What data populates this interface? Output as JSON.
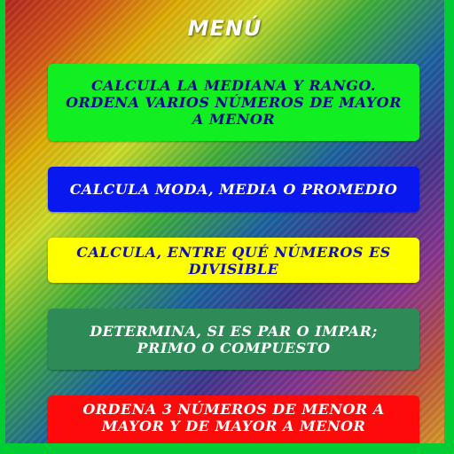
{
  "menu": {
    "title": "MENÚ",
    "items": [
      {
        "label": "CALCULA LA MEDIANA Y RANGO. ORDENA VARIOS NÚMEROS DE MAYOR A MENOR",
        "color": "#11ee22",
        "text_color": "#0a0a8a"
      },
      {
        "label": "CALCULA MODA,  MEDIA O PROMEDIO",
        "color": "#0a18f0",
        "text_color": "#ffffff"
      },
      {
        "label": "CALCULA, ENTRE QUÉ NÚMEROS ES DIVISIBLE",
        "color": "#ffff00",
        "text_color": "#1010b0"
      },
      {
        "label": "DETERMINA, SI ES PAR O IMPAR; PRIMO O COMPUESTO",
        "color": "#2e8b57",
        "text_color": "#ffffff"
      },
      {
        "label": "ORDENA 3 NÚMEROS DE MENOR A MAYOR Y DE MAYOR A MENOR",
        "color": "#ff0a0a",
        "text_color": "#ffffff"
      }
    ]
  },
  "colors": {
    "outer_border": "#00cc33",
    "title_text": "#ffffff"
  }
}
